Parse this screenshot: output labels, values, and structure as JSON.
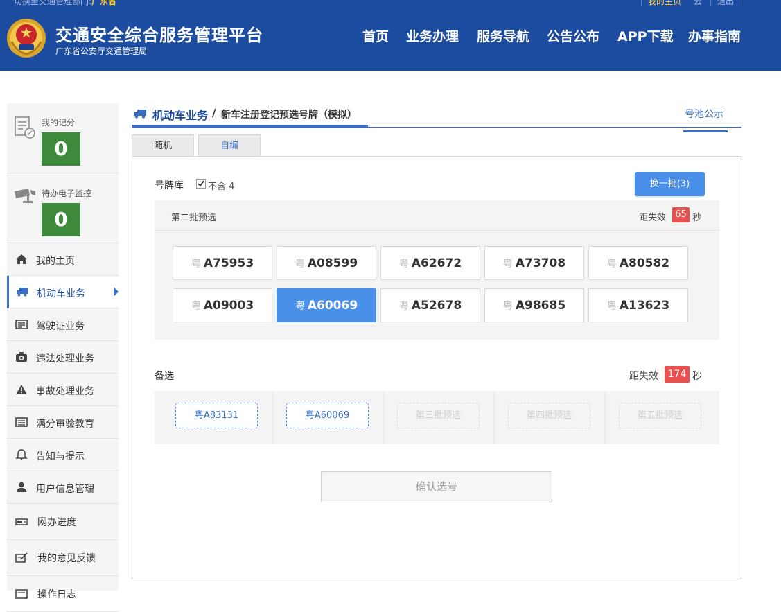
{
  "topbar": {
    "welcome_text": "切换至交通管理部门:",
    "region": "广东省",
    "home_link": "我的主页",
    "cloud_link": "云",
    "logout_link": "退出"
  },
  "header": {
    "title": "交通安全综合服务管理平台",
    "subtitle": "广东省公安厅交通管理局",
    "nav": [
      "首页",
      "业务办理",
      "服务导航",
      "公告公布",
      "APP下载",
      "办事指南"
    ]
  },
  "sidebar": {
    "score_label": "我的记分",
    "score_value": "0",
    "pending_label": "待办电子监控",
    "pending_value": "0",
    "items": [
      {
        "label": "我的主页",
        "icon": "home-icon"
      },
      {
        "label": "机动车业务",
        "icon": "truck-icon",
        "active": true
      },
      {
        "label": "驾驶证业务",
        "icon": "license-card-icon"
      },
      {
        "label": "违法处理业务",
        "icon": "camera-icon"
      },
      {
        "label": "事故处理业务",
        "icon": "warning-icon"
      },
      {
        "label": "满分审验教育",
        "icon": "list-icon"
      },
      {
        "label": "告知与提示",
        "icon": "bell-icon"
      },
      {
        "label": "用户信息管理",
        "icon": "user-icon"
      },
      {
        "label": "网办进度",
        "icon": "progress-icon"
      },
      {
        "label": "我的意见反馈",
        "icon": "feedback-icon"
      },
      {
        "label": "操作日志",
        "icon": "log-icon"
      }
    ]
  },
  "breadcrumb": {
    "main": "机动车业务",
    "separator": "/",
    "sub": "新车注册登记预选号牌（模拟）",
    "pool_link": "号池公示"
  },
  "tabs": [
    "随机",
    "自编"
  ],
  "library": {
    "label": "号牌库",
    "exclude_label": "不含 4",
    "exclude_checked": true,
    "swap_button": "换一批(3)"
  },
  "batch": {
    "title": "第二批预选",
    "expire_label": "距失效",
    "expire_seconds": "65",
    "unit": "秒",
    "province": "粤",
    "plates": [
      "A75953",
      "A08599",
      "A62672",
      "A73708",
      "A80582",
      "A09003",
      "A60069",
      "A52678",
      "A98685",
      "A13623"
    ],
    "selected_index": 6
  },
  "alternates": {
    "label": "备选",
    "expire_label": "距失效",
    "expire_seconds": "174",
    "unit": "秒",
    "slots": [
      "粤A83131",
      "粤A60069",
      "第三批预选",
      "第四批预选",
      "第五批预选"
    ],
    "filled_count": 2
  },
  "confirm_button": "确认选号",
  "colors": {
    "header_blue": "#1c4c9f",
    "accent_blue": "#4a8fe8",
    "score_green": "#3d8a3d",
    "timer_red": "#e85050"
  }
}
